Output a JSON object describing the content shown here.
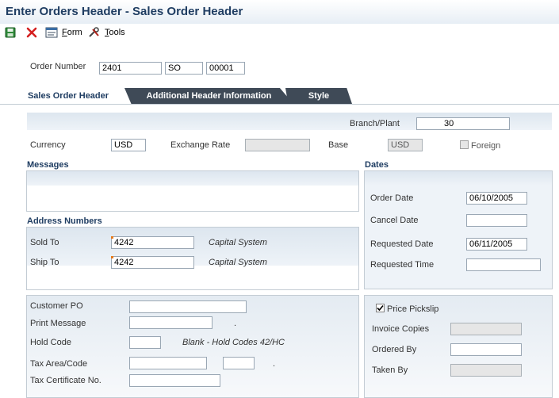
{
  "window": {
    "title": "Enter Orders Header - Sales Order Header"
  },
  "toolbar": {
    "save_icon": "save-icon",
    "cancel_icon": "close-icon",
    "form_label": "Form",
    "form_mnemonic": "F",
    "tools_label": "Tools",
    "tools_mnemonic": "T"
  },
  "order": {
    "label": "Order Number",
    "number": "2401",
    "type": "SO",
    "company": "00001"
  },
  "tabs": [
    {
      "label": "Sales Order Header",
      "active": true
    },
    {
      "label": "Additional Header Information",
      "active": false
    },
    {
      "label": "Style",
      "active": false
    }
  ],
  "header_fields": {
    "branch_label": "Branch/Plant",
    "branch_value": "30",
    "currency_label": "Currency",
    "currency_value": "USD",
    "exchange_label": "Exchange Rate",
    "exchange_value": "",
    "base_label": "Base",
    "base_value": "USD",
    "foreign_label": "Foreign",
    "foreign_checked": false
  },
  "messages": {
    "title": "Messages"
  },
  "address": {
    "title": "Address Numbers",
    "sold_to_label": "Sold To",
    "sold_to_value": "4242",
    "sold_to_name": "Capital System",
    "ship_to_label": "Ship To",
    "ship_to_value": "4242",
    "ship_to_name": "Capital System"
  },
  "dates": {
    "title": "Dates",
    "order_date_label": "Order Date",
    "order_date_value": "06/10/2005",
    "cancel_date_label": "Cancel Date",
    "cancel_date_value": "",
    "requested_date_label": "Requested Date",
    "requested_date_value": "06/11/2005",
    "requested_time_label": "Requested Time",
    "requested_time_value": ""
  },
  "misc": {
    "customer_po_label": "Customer PO",
    "print_message_label": "Print Message",
    "hold_code_label": "Hold Code",
    "hold_code_desc": "Blank - Hold Codes 42/HC",
    "tax_area_label": "Tax Area/Code",
    "tax_cert_label": "Tax Certificate No.",
    "dot1": ".",
    "dot2": "."
  },
  "pickslip": {
    "price_pickslip_label": "Price Pickslip",
    "price_pickslip_checked": true,
    "invoice_copies_label": "Invoice Copies",
    "ordered_by_label": "Ordered By",
    "taken_by_label": "Taken By"
  }
}
